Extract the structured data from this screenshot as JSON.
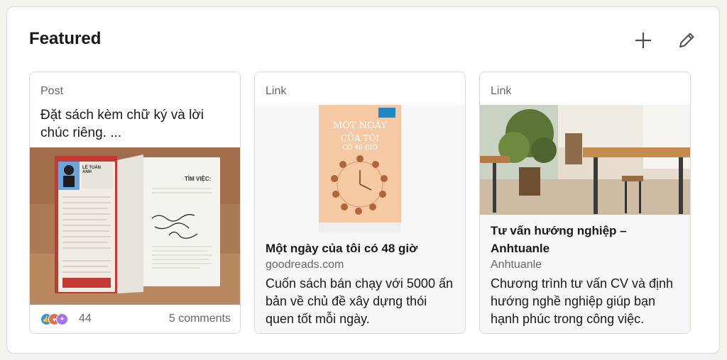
{
  "section": {
    "title": "Featured"
  },
  "cards": [
    {
      "type": "Post",
      "text": "Đặt sách kèm chữ ký và lời chúc riêng. ...",
      "reaction_count": "44",
      "comments": "5 comments",
      "book_cover_name": "LÊ TUẤN ANH",
      "book_inner_title": "TÌM VIỆC:"
    },
    {
      "type": "Link",
      "title": "Một ngày của tôi có 48 giờ",
      "source": "goodreads.com",
      "description": "Cuốn sách bán chạy với 5000 ấn bản về chủ đề xây dựng thói quen tốt mỗi ngày.",
      "book_title_top": "MỘT NGÀY",
      "book_title_mid": "CỦA TÔI",
      "book_title_bot": "CÓ 48 GIỜ"
    },
    {
      "type": "Link",
      "title": "Tư vấn hướng nghiệp – Anhtuanle",
      "source": "Anhtuanle",
      "description": "Chương trình tư vấn CV và định hướng nghề nghiệp giúp bạn hạnh phúc trong công việc."
    }
  ],
  "icons": {
    "add": "plus-icon",
    "edit": "pencil-icon"
  },
  "colors": {
    "panel_bg": "#ffffff",
    "page_bg": "#f3f2ef",
    "muted_text": "#666666",
    "link_bg": "#f6f7f8",
    "like_blue": "#378fe9",
    "celebrate_green": "#6dae4f",
    "love_red": "#df704d"
  }
}
